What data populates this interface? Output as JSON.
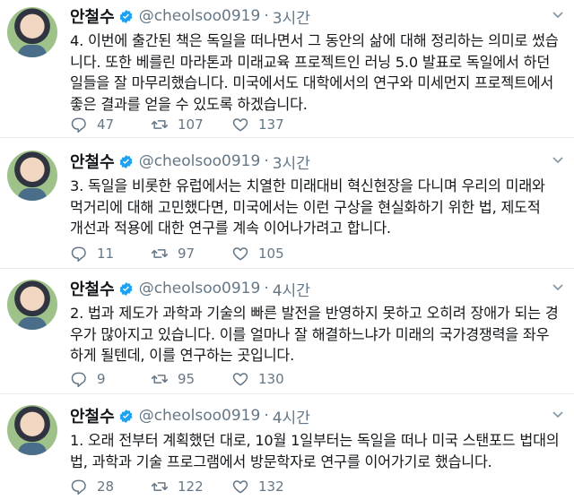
{
  "tweets": [
    {
      "name": "안철수",
      "handle": "@cheolsoo0919",
      "separator": "·",
      "time": "3시간",
      "lines": [
        "4. 이번에 출간된 책은 독일을 떠나면서 그 동안의 삶에 대해 정리하는 의미로 썼습",
        "니다. 또한 베를린 마라톤과 미래교육 프로젝트인 러닝 5.0 발표로 독일에서 하던",
        "일들을 잘 마무리했습니다. 미국에서도 대학에서의 연구와 미세먼지 프로젝트에서",
        "좋은 결과를 얻을 수 있도록 하겠습니다."
      ],
      "replies": "47",
      "retweets": "107",
      "likes": "137"
    },
    {
      "name": "안철수",
      "handle": "@cheolsoo0919",
      "separator": "·",
      "time": "3시간",
      "lines": [
        "3. 독일을 비롯한 유럽에서는 치열한 미래대비 혁신현장을 다니며 우리의 미래와",
        "먹거리에 대해 고민했다면, 미국에서는 이런 구상을 현실화하기 위한 법, 제도적",
        "개선과 적용에 대한 연구를 계속 이어나가려고 합니다."
      ],
      "replies": "11",
      "retweets": "97",
      "likes": "105"
    },
    {
      "name": "안철수",
      "handle": "@cheolsoo0919",
      "separator": "·",
      "time": "4시간",
      "lines": [
        "2. 법과 제도가 과학과 기술의 빠른 발전을 반영하지 못하고 오히려 장애가 되는 경",
        "우가 많아지고 있습니다. 이를 얼마나 잘 해결하느냐가 미래의 국가경쟁력을 좌우",
        "하게 될텐데, 이를 연구하는 곳입니다."
      ],
      "replies": "9",
      "retweets": "95",
      "likes": "130"
    },
    {
      "name": "안철수",
      "handle": "@cheolsoo0919",
      "separator": "·",
      "time": "4시간",
      "lines": [
        "1. 오래 전부터 계획했던 대로, 10월 1일부터는 독일을 떠나 미국 스탠포드 법대의",
        "법, 과학과 기술 프로그램에서 방문학자로 연구를 이어가기로 했습니다."
      ],
      "replies": "28",
      "retweets": "122",
      "likes": "132"
    }
  ],
  "colors": {
    "text": "#14171a",
    "muted": "#657786",
    "verified": "#1da1f2",
    "divider": "#e6ecf0"
  },
  "icons": {
    "verified": "verified-badge-icon",
    "chevron": "chevron-down-icon",
    "reply": "reply-icon",
    "retweet": "retweet-icon",
    "like": "heart-icon"
  }
}
